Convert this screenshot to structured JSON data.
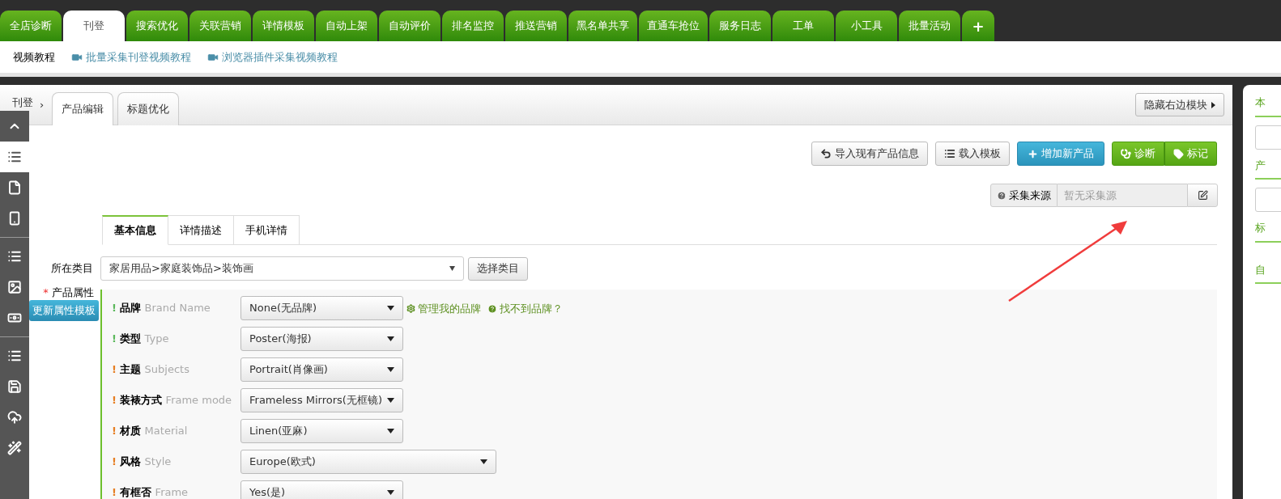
{
  "top_tabs": [
    {
      "label": "全店诊断",
      "selected": false
    },
    {
      "label": "刊登",
      "selected": true
    },
    {
      "label": "搜索优化",
      "selected": false
    },
    {
      "label": "关联营销",
      "selected": false
    },
    {
      "label": "详情模板",
      "selected": false
    },
    {
      "label": "自动上架",
      "selected": false
    },
    {
      "label": "自动评价",
      "selected": false
    },
    {
      "label": "排名监控",
      "selected": false
    },
    {
      "label": "推送营销",
      "selected": false
    },
    {
      "label": "黑名单共享",
      "selected": false
    },
    {
      "label": "直通车抢位",
      "selected": false
    },
    {
      "label": "服务日志",
      "selected": false
    },
    {
      "label": "工单",
      "selected": false
    },
    {
      "label": "小工具",
      "selected": false
    },
    {
      "label": "批量活动",
      "selected": false
    }
  ],
  "add_tab": "+",
  "video_bar": {
    "title": "视频教程",
    "links": [
      "批量采集刊登视频教程",
      "浏览器插件采集视频教程"
    ]
  },
  "sidebar": {
    "items": [
      {
        "selected": false
      },
      {
        "selected": true
      },
      {
        "selected": false
      },
      {
        "selected": false
      },
      {
        "selected": false
      },
      {
        "selected": false
      },
      {
        "selected": false
      },
      {
        "selected": false
      },
      {
        "selected": false
      },
      {
        "selected": false
      },
      {
        "selected": false
      }
    ]
  },
  "breadcrumb": {
    "label": "刊登",
    "separator": "›"
  },
  "page_tabs": [
    {
      "label": "产品编辑",
      "selected": true
    },
    {
      "label": "标题优化",
      "selected": false
    }
  ],
  "hide_right_button": "隐藏右边模块",
  "actions": [
    "导入现有产品信息",
    "载入模板",
    "增加新产品",
    "诊断",
    "标记"
  ],
  "source": {
    "label": "采集来源",
    "placeholder": "暂无采集源"
  },
  "form_tabs": [
    {
      "label": "基本信息",
      "selected": true
    },
    {
      "label": "详情描述",
      "selected": false
    },
    {
      "label": "手机详情",
      "selected": false
    }
  ],
  "category": {
    "label": "所在类目",
    "value": "家居用品>家庭装饰品>装饰画",
    "button": "选择类目"
  },
  "attributes": {
    "required_mark": "*",
    "label": "产品属性",
    "template_button": "更新属性模板",
    "links": [
      "管理我的品牌",
      "找不到品牌？"
    ],
    "rows": [
      {
        "mark": "!",
        "color": "#5cb85c",
        "name": "品牌",
        "english": "Brand Name",
        "value": "None(无品牌)",
        "kind": "normal"
      },
      {
        "mark": "!",
        "color": "#5cb85c",
        "name": "类型",
        "english": "Type",
        "value": "Poster(海报)",
        "kind": "normal"
      },
      {
        "mark": "!",
        "color": "#e67e22",
        "name": "主题",
        "english": "Subjects",
        "value": "Portrait(肖像画)",
        "kind": "normal"
      },
      {
        "mark": "!",
        "color": "#e67e22",
        "name": "装裱方式",
        "english": "Frame mode",
        "value": "Frameless Mirrors(无框镜)",
        "kind": "normal"
      },
      {
        "mark": "!",
        "color": "#e67e22",
        "name": "材质",
        "english": "Material",
        "value": "Linen(亚麻)",
        "kind": "normal"
      },
      {
        "mark": "!",
        "color": "#e67e22",
        "name": "风格",
        "english": "Style",
        "value": "Europe(欧式)",
        "kind": "wide"
      },
      {
        "mark": "!",
        "color": "#e67e22",
        "name": "有框否",
        "english": "Frame",
        "value": "Yes(是)",
        "kind": "normal"
      }
    ]
  },
  "right_panel": {
    "sections": [
      {
        "label": "本"
      },
      {
        "label": "产"
      },
      {
        "label": "标"
      },
      {
        "label": "自"
      }
    ]
  }
}
